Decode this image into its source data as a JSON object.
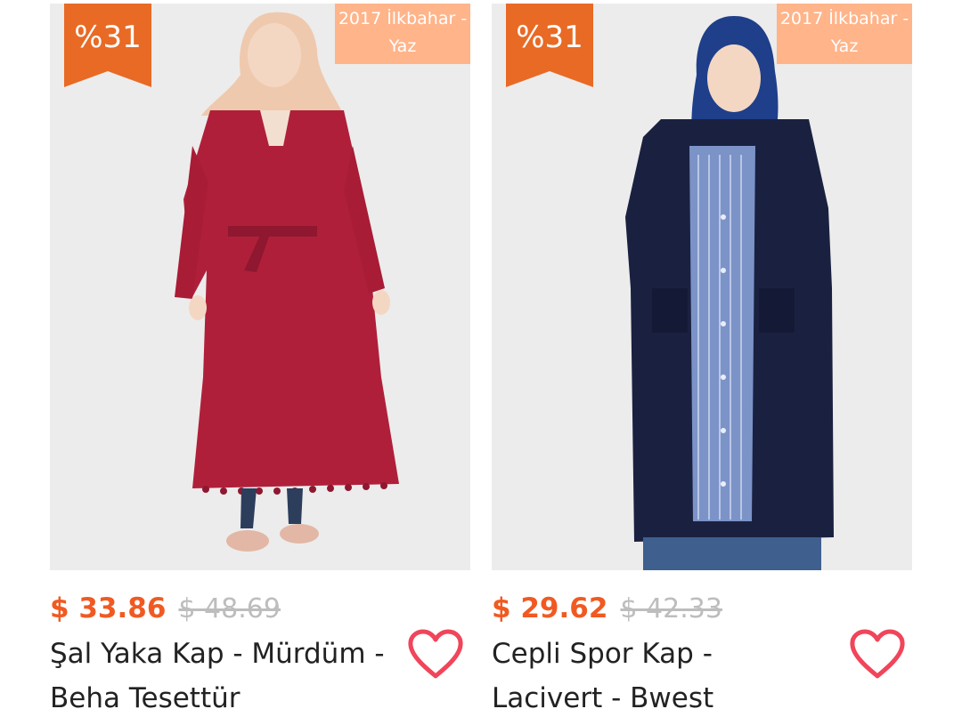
{
  "products": [
    {
      "discount": "%31",
      "season": "2017 İlkbahar - Yaz",
      "price_current": "$ 33.86",
      "price_old": "$ 48.69",
      "title": "Şal Yaka Kap - Mürdüm - Beha Tesettür"
    },
    {
      "discount": "%31",
      "season": "2017 İlkbahar - Yaz",
      "price_current": "$ 29.62",
      "price_old": "$ 42.33",
      "title": "Cepli Spor Kap - Lacivert - Bwest"
    }
  ],
  "colors": {
    "accent": "#f05a22",
    "ribbon": "#e86a25",
    "season_badge": "#ffb48a",
    "heart": "#f0455a",
    "old_price": "#bdbdbd"
  },
  "icons": {
    "favorite": "heart-outline-icon"
  }
}
